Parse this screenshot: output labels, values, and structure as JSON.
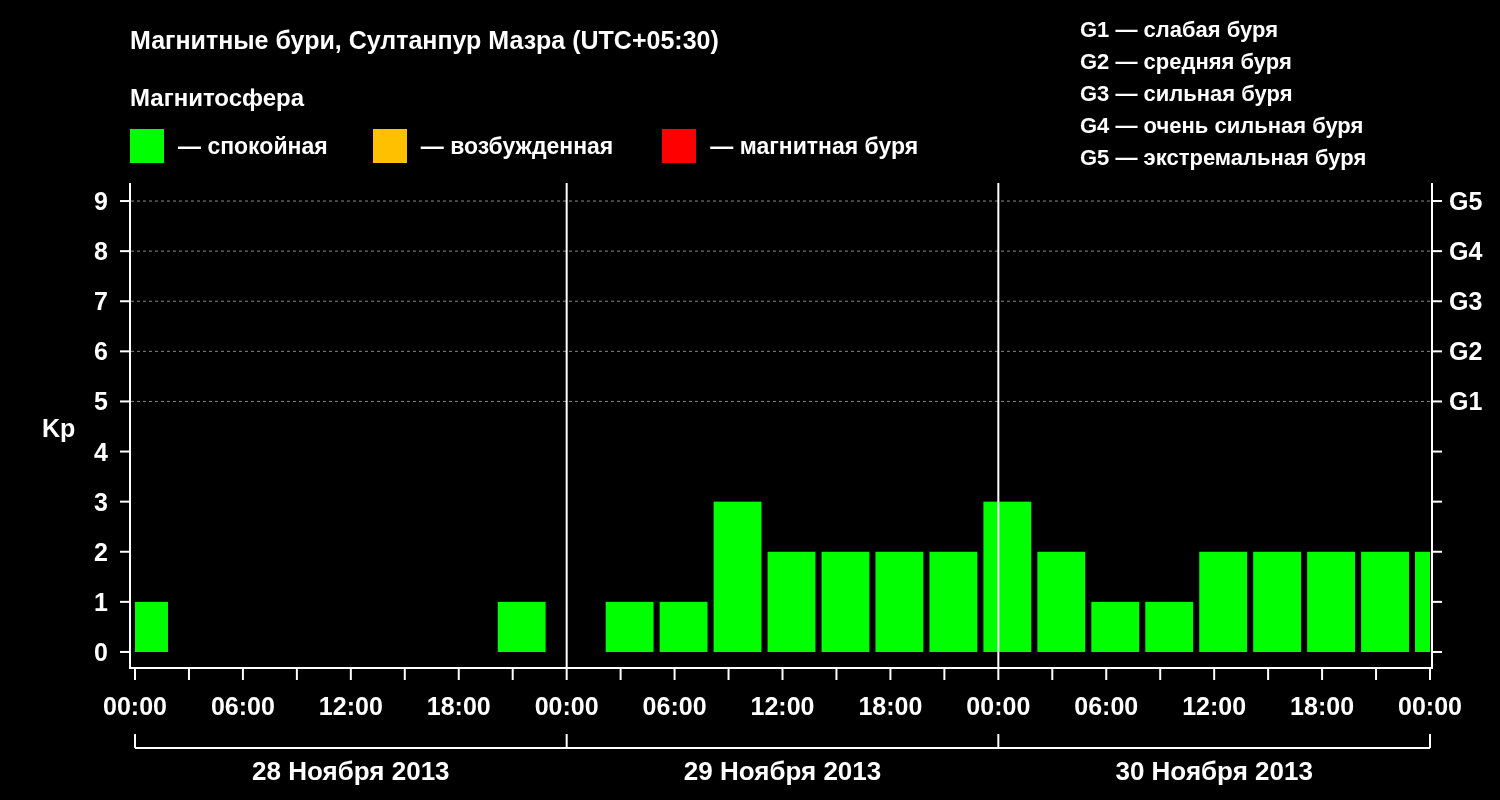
{
  "title": "Магнитные бури, Султанпур Мазра (UTC+05:30)",
  "legend_title": "Магнитосфера",
  "legend": [
    {
      "label": "— спокойная",
      "color": "#00ff00"
    },
    {
      "label": "— возбужденная",
      "color": "#ffc000"
    },
    {
      "label": "— магнитная буря",
      "color": "#ff0000"
    }
  ],
  "storm_scale": [
    "G1 — слабая буря",
    "G2 — средняя буря",
    "G3 — сильная буря",
    "G4 — очень сильная буря",
    "G5 — экстремальная буря"
  ],
  "chart": {
    "chart_data": {
      "type": "bar",
      "ylabel": "Kp",
      "grid": true,
      "x": [
        "2013-11-28 00:55",
        null,
        null,
        null,
        null,
        null,
        null,
        "2013-11-28 21:30",
        null,
        "2013-11-29 03:30",
        "2013-11-29 06:30",
        "2013-11-29 09:30",
        "2013-11-29 12:30",
        "2013-11-29 15:30",
        "2013-11-29 18:30",
        "2013-11-29 21:30",
        "2013-11-30 00:30",
        "2013-11-30 03:30",
        "2013-11-30 06:30",
        "2013-11-30 09:30",
        "2013-11-30 12:30",
        "2013-11-30 15:30",
        "2013-11-30 18:30",
        "2013-11-30 21:30",
        "2013-11-30 23:35"
      ],
      "series": [
        {
          "color": "#00ff00",
          "values": [
            1,
            null,
            null,
            null,
            null,
            null,
            null,
            1,
            null,
            1,
            1,
            3,
            2,
            2,
            2,
            2,
            3,
            2,
            1,
            1,
            2,
            2,
            2,
            2,
            2
          ]
        }
      ],
      "xlim": [
        "2013-11-28 00:00",
        "2013-12-01 00:00"
      ],
      "ylim": [
        -0.32,
        9.36
      ],
      "xticks": [
        {
          "value": "2013-11-28 00:00",
          "label": "00:00"
        },
        {
          "value": "2013-11-28 06:00",
          "label": "06:00"
        },
        {
          "value": "2013-11-28 12:00",
          "label": "12:00"
        },
        {
          "value": "2013-11-28 18:00",
          "label": "18:00"
        },
        {
          "value": "2013-11-29 00:00",
          "label": "00:00"
        },
        {
          "value": "2013-11-29 06:00",
          "label": "06:00"
        },
        {
          "value": "2013-11-29 12:00",
          "label": "12:00"
        },
        {
          "value": "2013-11-29 18:00",
          "label": "18:00"
        },
        {
          "value": "2013-11-30 00:00",
          "label": "00:00"
        },
        {
          "value": "2013-11-30 06:00",
          "label": "06:00"
        },
        {
          "value": "2013-11-30 12:00",
          "label": "12:00"
        },
        {
          "value": "2013-11-30 18:00",
          "label": "18:00"
        },
        {
          "value": "2013-12-01 00:00",
          "label": "00:00"
        }
      ],
      "yticks": [
        0,
        1,
        2,
        3,
        4,
        5,
        6,
        7,
        8,
        9
      ]
    },
    "g_labels": [
      "G5",
      "G4",
      "G3",
      "G2",
      "G1"
    ],
    "dates": [
      "28 Ноября 2013",
      "29 Ноября 2013",
      "30 Ноября 2013"
    ]
  }
}
